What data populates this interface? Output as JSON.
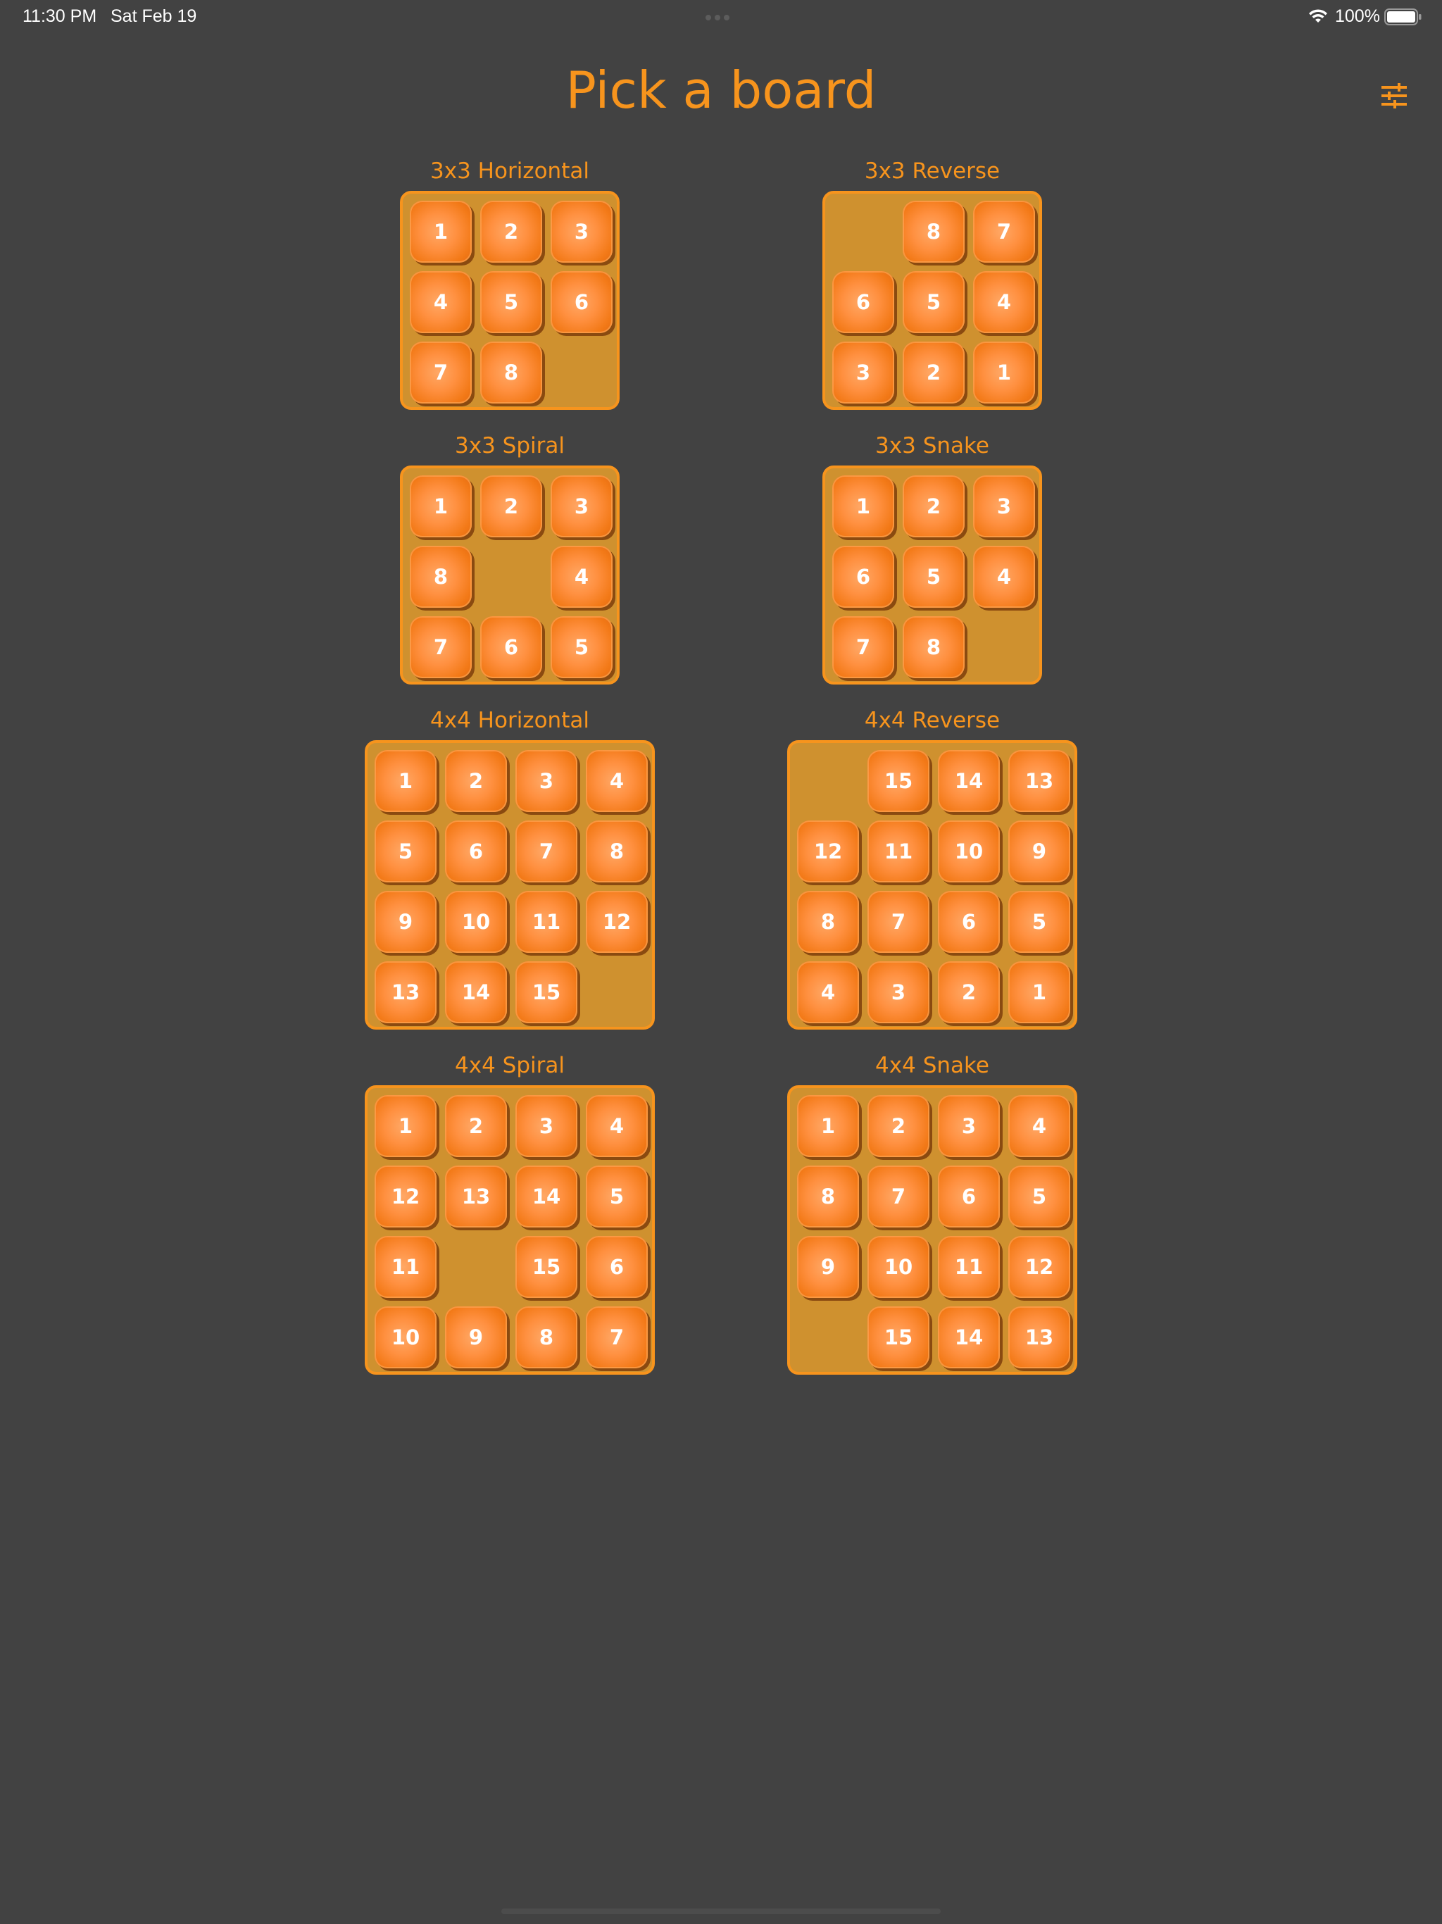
{
  "status_bar": {
    "time": "11:30 PM",
    "date": "Sat Feb 19",
    "battery": "100%"
  },
  "header": {
    "title": "Pick a board",
    "settings_icon": "sliders-icon"
  },
  "colors": {
    "background": "#424242",
    "accent": "#f7941d",
    "board_fill": "#cf912f",
    "tile": "#ff9040",
    "tile_text": "#ffffff"
  },
  "boards": [
    {
      "label": "3x3 Horizontal",
      "size": 3,
      "tiles": [
        1,
        2,
        3,
        4,
        5,
        6,
        7,
        8,
        null
      ]
    },
    {
      "label": "3x3 Reverse",
      "size": 3,
      "tiles": [
        null,
        8,
        7,
        6,
        5,
        4,
        3,
        2,
        1
      ]
    },
    {
      "label": "3x3 Spiral",
      "size": 3,
      "tiles": [
        1,
        2,
        3,
        8,
        null,
        4,
        7,
        6,
        5
      ]
    },
    {
      "label": "3x3 Snake",
      "size": 3,
      "tiles": [
        1,
        2,
        3,
        6,
        5,
        4,
        7,
        8,
        null
      ]
    },
    {
      "label": "4x4 Horizontal",
      "size": 4,
      "tiles": [
        1,
        2,
        3,
        4,
        5,
        6,
        7,
        8,
        9,
        10,
        11,
        12,
        13,
        14,
        15,
        null
      ]
    },
    {
      "label": "4x4 Reverse",
      "size": 4,
      "tiles": [
        null,
        15,
        14,
        13,
        12,
        11,
        10,
        9,
        8,
        7,
        6,
        5,
        4,
        3,
        2,
        1
      ]
    },
    {
      "label": "4x4 Spiral",
      "size": 4,
      "tiles": [
        1,
        2,
        3,
        4,
        12,
        13,
        14,
        5,
        11,
        null,
        15,
        6,
        10,
        9,
        8,
        7
      ]
    },
    {
      "label": "4x4 Snake",
      "size": 4,
      "tiles": [
        1,
        2,
        3,
        4,
        8,
        7,
        6,
        5,
        9,
        10,
        11,
        12,
        null,
        15,
        14,
        13
      ]
    }
  ]
}
